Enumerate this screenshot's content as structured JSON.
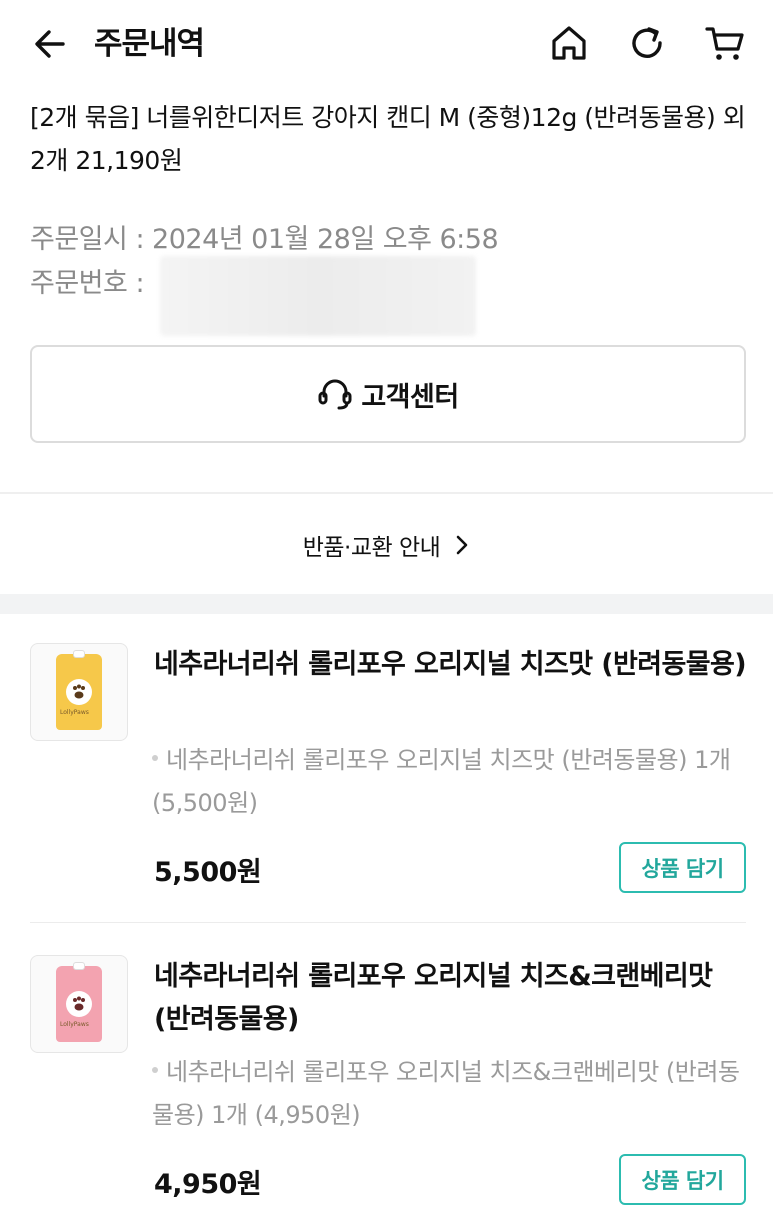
{
  "header": {
    "title": "주문내역",
    "icons": [
      "back-arrow-icon",
      "home-icon",
      "refresh-icon",
      "cart-icon"
    ]
  },
  "order": {
    "title": "[2개 묶음] 너를위한디저트 강아지 캔디 M (중형)12g (반려동물용) 외 2개 21,190원",
    "date_label": "주문일시 :",
    "date_value": "2024년 01월 28일 오후 6:58",
    "number_label": "주문번호 :"
  },
  "support": {
    "label": "고객센터",
    "icon": "headset-icon"
  },
  "return_link": {
    "label": "반품·교환 안내"
  },
  "items": [
    {
      "name": "네추라너리쉬 롤리포우 오리지널 치즈맛 (반려동물용)",
      "option": "네추라너리쉬 롤리포우 오리지널 치즈맛 (반려동물용) 1개 (5,500원)",
      "price": "5,500원",
      "button": "상품 담기",
      "package_color": "#f6c84a",
      "brand": "LollyPaws"
    },
    {
      "name": "네추라너리쉬 롤리포우 오리지널 치즈&크랜베리맛 (반려동물용)",
      "option": "네추라너리쉬 롤리포우 오리지널 치즈&크랜베리맛 (반려동물용) 1개 (4,950원)",
      "price": "4,950원",
      "button": "상품 담기",
      "package_color": "#f3a3b0",
      "brand": "LollyPaws"
    }
  ],
  "colors": {
    "accent": "#2cbcb0",
    "muted_text": "#8a8a8a",
    "border": "#dcdcdc"
  }
}
